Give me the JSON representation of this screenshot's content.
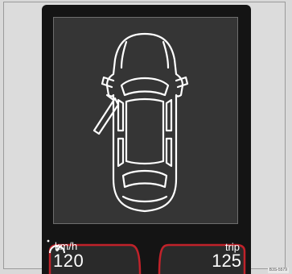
{
  "display": {
    "icon": "car-top-view-open-door-icon",
    "open_door": "front-left"
  },
  "speed": {
    "unit": "km/h",
    "value": "120",
    "icon": "speedometer-icon"
  },
  "trip": {
    "label": "trip",
    "value": "125"
  },
  "figure_code": "B3S-5579",
  "colors": {
    "screen_bg": "#353535",
    "bezel": "#141414",
    "outline": "#ffffff",
    "gauge_accent": "#c0222a"
  }
}
